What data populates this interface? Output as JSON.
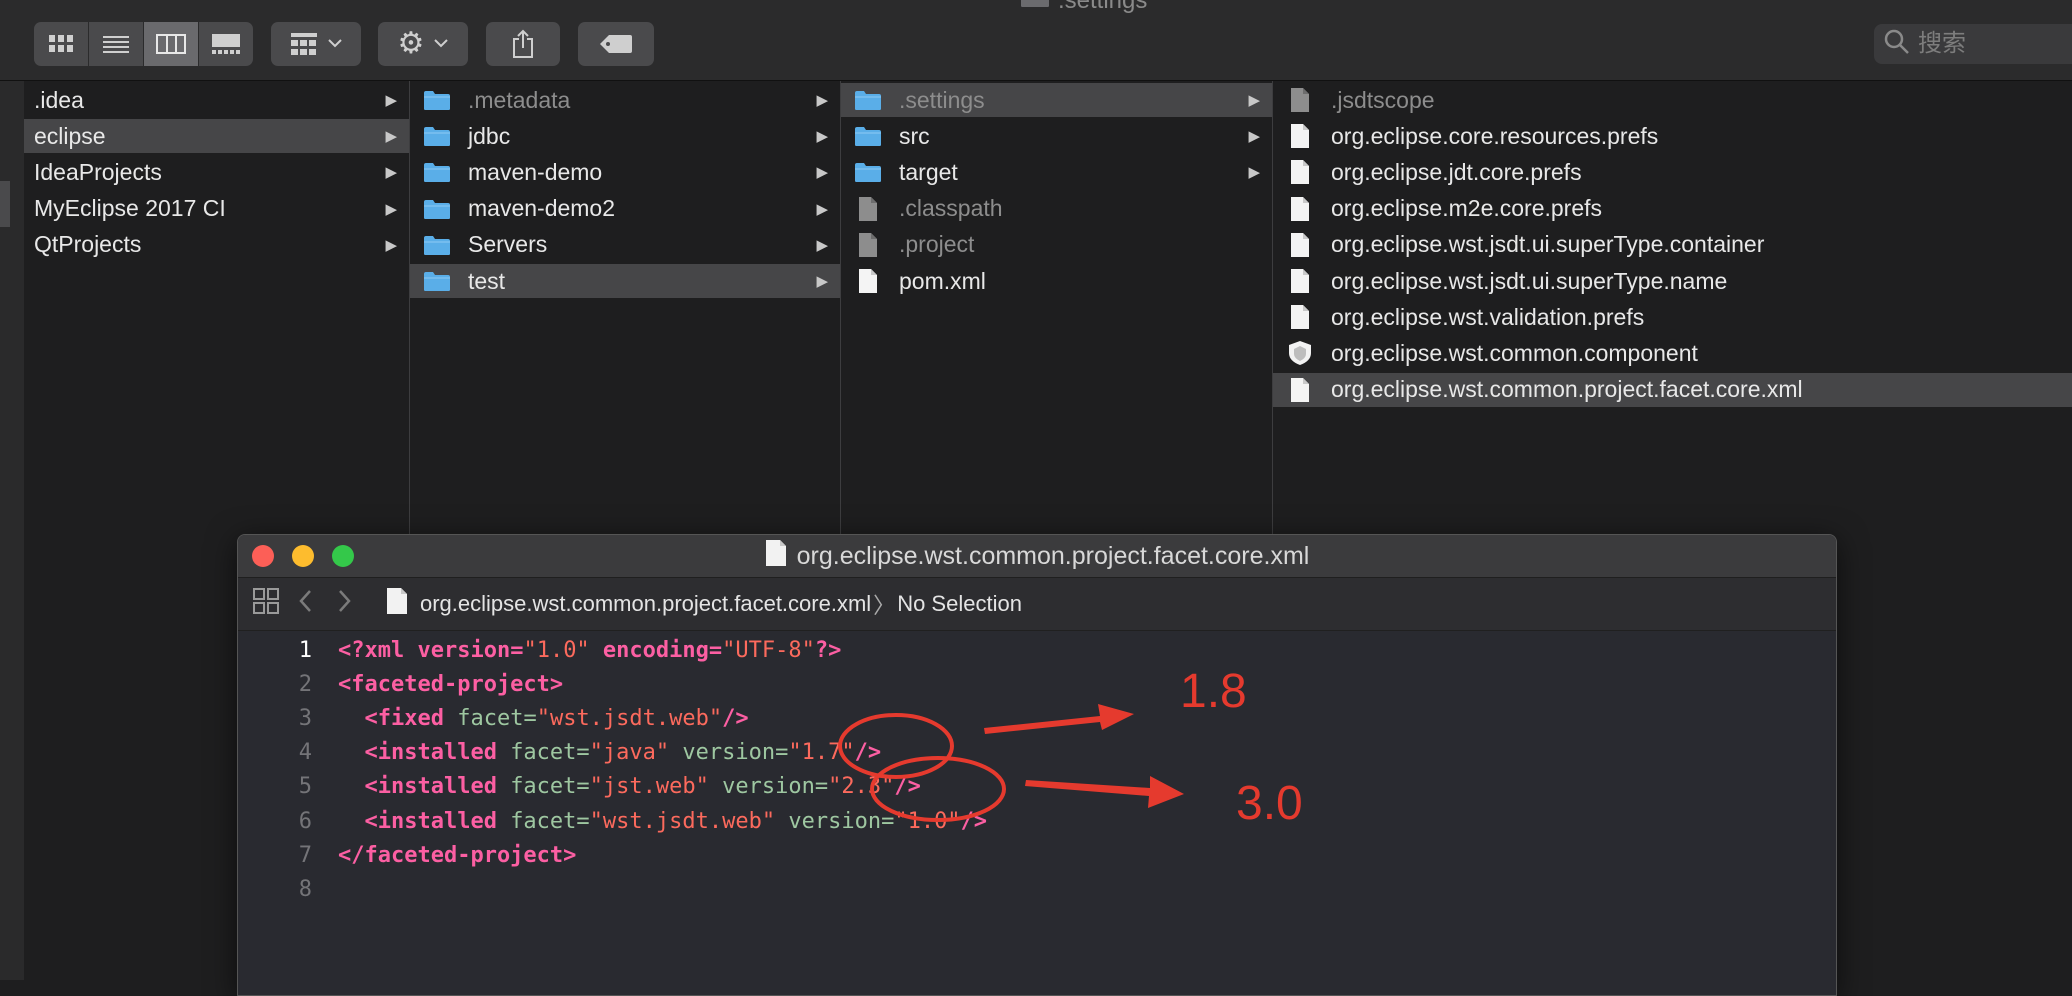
{
  "window": {
    "title": ".settings"
  },
  "toolbar": {
    "search_placeholder": "搜索"
  },
  "columns": [
    {
      "items": [
        {
          "label": ".idea",
          "kind": "none",
          "arrow": true,
          "selected": false,
          "dim": false
        },
        {
          "label": "eclipse",
          "kind": "none",
          "arrow": true,
          "selected": true,
          "dim": false
        },
        {
          "label": "IdeaProjects",
          "kind": "none",
          "arrow": true,
          "selected": false,
          "dim": false
        },
        {
          "label": "MyEclipse 2017 CI",
          "kind": "none",
          "arrow": true,
          "selected": false,
          "dim": false
        },
        {
          "label": "QtProjects",
          "kind": "none",
          "arrow": true,
          "selected": false,
          "dim": false
        }
      ]
    },
    {
      "items": [
        {
          "label": ".metadata",
          "kind": "folder",
          "arrow": true,
          "selected": false,
          "dim": true
        },
        {
          "label": "jdbc",
          "kind": "folder",
          "arrow": true,
          "selected": false,
          "dim": false
        },
        {
          "label": "maven-demo",
          "kind": "folder",
          "arrow": true,
          "selected": false,
          "dim": false
        },
        {
          "label": "maven-demo2",
          "kind": "folder",
          "arrow": true,
          "selected": false,
          "dim": false
        },
        {
          "label": "Servers",
          "kind": "folder",
          "arrow": true,
          "selected": false,
          "dim": false
        },
        {
          "label": "test",
          "kind": "folder",
          "arrow": true,
          "selected": true,
          "dim": false
        }
      ]
    },
    {
      "items": [
        {
          "label": ".settings",
          "kind": "folder",
          "arrow": true,
          "selected": true,
          "dim": true
        },
        {
          "label": "src",
          "kind": "folder",
          "arrow": true,
          "selected": false,
          "dim": false
        },
        {
          "label": "target",
          "kind": "folder",
          "arrow": true,
          "selected": false,
          "dim": false
        },
        {
          "label": ".classpath",
          "kind": "file-gray",
          "arrow": false,
          "selected": false,
          "dim": true
        },
        {
          "label": ".project",
          "kind": "file-gray",
          "arrow": false,
          "selected": false,
          "dim": true
        },
        {
          "label": "pom.xml",
          "kind": "file",
          "arrow": false,
          "selected": false,
          "dim": false
        }
      ]
    },
    {
      "items": [
        {
          "label": ".jsdtscope",
          "kind": "file-gray",
          "arrow": false,
          "selected": false,
          "dim": true
        },
        {
          "label": "org.eclipse.core.resources.prefs",
          "kind": "file",
          "arrow": false,
          "selected": false,
          "dim": false
        },
        {
          "label": "org.eclipse.jdt.core.prefs",
          "kind": "file",
          "arrow": false,
          "selected": false,
          "dim": false
        },
        {
          "label": "org.eclipse.m2e.core.prefs",
          "kind": "file",
          "arrow": false,
          "selected": false,
          "dim": false
        },
        {
          "label": "org.eclipse.wst.jsdt.ui.superType.container",
          "kind": "file",
          "arrow": false,
          "selected": false,
          "dim": false
        },
        {
          "label": "org.eclipse.wst.jsdt.ui.superType.name",
          "kind": "file",
          "arrow": false,
          "selected": false,
          "dim": false
        },
        {
          "label": "org.eclipse.wst.validation.prefs",
          "kind": "file",
          "arrow": false,
          "selected": false,
          "dim": false
        },
        {
          "label": "org.eclipse.wst.common.component",
          "kind": "shield",
          "arrow": false,
          "selected": false,
          "dim": false
        },
        {
          "label": "org.eclipse.wst.common.project.facet.core.xml",
          "kind": "file",
          "arrow": false,
          "selected": true,
          "dim": false
        }
      ]
    }
  ],
  "editor": {
    "title": "org.eclipse.wst.common.project.facet.core.xml",
    "breadcrumb_file": "org.eclipse.wst.common.project.facet.core.xml",
    "breadcrumb_separator": "〉",
    "breadcrumb_selection": "No Selection",
    "current_line": 1,
    "lines": [
      {
        "n": "1",
        "segments": [
          {
            "t": "<?xml ",
            "c": "pi"
          },
          {
            "t": "version=",
            "c": "pi"
          },
          {
            "t": "\"1.0\"",
            "c": "str"
          },
          {
            "t": " encoding=",
            "c": "pi"
          },
          {
            "t": "\"UTF-8\"",
            "c": "str"
          },
          {
            "t": "?>",
            "c": "pi"
          }
        ]
      },
      {
        "n": "2",
        "segments": [
          {
            "t": "<faceted-project>",
            "c": "tag"
          }
        ]
      },
      {
        "n": "3",
        "segments": [
          {
            "t": "  <fixed ",
            "c": "tag"
          },
          {
            "t": "facet=",
            "c": "attr"
          },
          {
            "t": "\"wst.jsdt.web\"",
            "c": "str"
          },
          {
            "t": "/>",
            "c": "tag"
          }
        ]
      },
      {
        "n": "4",
        "segments": [
          {
            "t": "  <installed ",
            "c": "tag"
          },
          {
            "t": "facet=",
            "c": "attr"
          },
          {
            "t": "\"java\"",
            "c": "str"
          },
          {
            "t": " version=",
            "c": "attr"
          },
          {
            "t": "\"1.7\"",
            "c": "str"
          },
          {
            "t": "/>",
            "c": "tag"
          }
        ]
      },
      {
        "n": "5",
        "segments": [
          {
            "t": "  <installed ",
            "c": "tag"
          },
          {
            "t": "facet=",
            "c": "attr"
          },
          {
            "t": "\"jst.web\"",
            "c": "str"
          },
          {
            "t": " version=",
            "c": "attr"
          },
          {
            "t": "\"2.3\"",
            "c": "str"
          },
          {
            "t": "/>",
            "c": "tag"
          }
        ]
      },
      {
        "n": "6",
        "segments": [
          {
            "t": "  <installed ",
            "c": "tag"
          },
          {
            "t": "facet=",
            "c": "attr"
          },
          {
            "t": "\"wst.jsdt.web\"",
            "c": "str"
          },
          {
            "t": " version=",
            "c": "attr"
          },
          {
            "t": "\"1.0\"",
            "c": "str"
          },
          {
            "t": "/>",
            "c": "tag"
          }
        ]
      },
      {
        "n": "7",
        "segments": [
          {
            "t": "</faceted-project>",
            "c": "tag"
          }
        ]
      },
      {
        "n": "8",
        "segments": []
      }
    ]
  },
  "annotations": {
    "label_java": "1.8",
    "label_web": "3.0",
    "color": "#e53a2e"
  },
  "colors": {
    "folder": "#5aaee8",
    "traffic_close": "#fc5f57",
    "traffic_min": "#fdbc2e",
    "traffic_max": "#34c84a"
  }
}
